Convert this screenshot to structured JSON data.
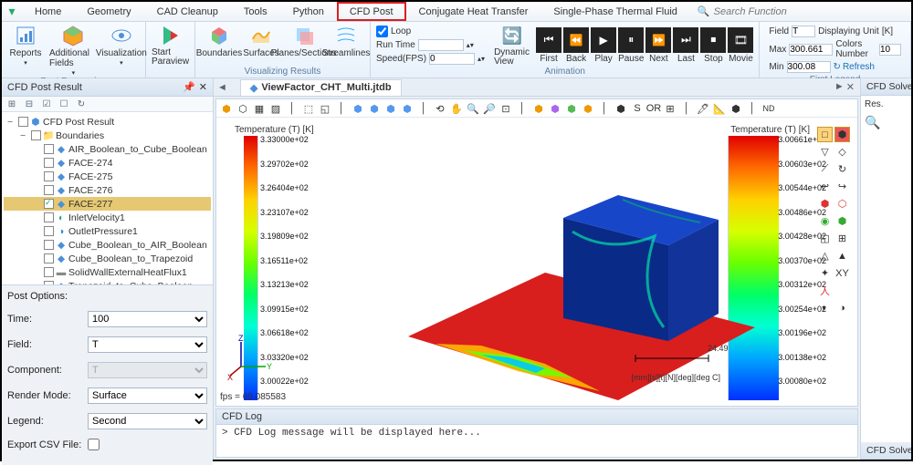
{
  "menubar": {
    "tabs": [
      "Home",
      "Geometry",
      "CAD Cleanup",
      "Tools",
      "Python",
      "CFD Post",
      "Conjugate Heat Transfer",
      "Single-Phase Thermal Fluid"
    ],
    "highlighted": "CFD Post",
    "search_placeholder": "Search Function"
  },
  "ribbon": {
    "groups": [
      {
        "label": "Post Processing",
        "items": [
          "Reports",
          "Additional Fields",
          "Visualization"
        ]
      },
      {
        "label": "",
        "items": [
          "Start Paraview"
        ]
      },
      {
        "label": "Visualizing Results",
        "items": [
          "Boundaries",
          "Surfaces",
          "Planes/Sections",
          "Streamlines"
        ]
      },
      {
        "label": "Animation",
        "loop": "Loop",
        "runtime": "Run Time",
        "speed": "Speed(FPS)",
        "speed_val": "0",
        "buttons": [
          "Dynamic View",
          "First",
          "Back",
          "Play",
          "Pause",
          "Next",
          "Last",
          "Stop",
          "Movie"
        ]
      },
      {
        "label": "First Legend",
        "field_lbl": "Field",
        "field_val": "T",
        "unit_lbl": "Displaying Unit",
        "unit_val": "[K]",
        "max_lbl": "Max",
        "max_val": "300.661",
        "colors_lbl": "Colors Number",
        "colors_val": "10",
        "min_lbl": "Min",
        "min_val": "300.08",
        "refresh": "Refresh"
      }
    ]
  },
  "left_panel": {
    "title": "CFD Post Result",
    "tree": [
      {
        "level": 0,
        "check": false,
        "icon": "cube",
        "label": "CFD Post Result",
        "expand": "−"
      },
      {
        "level": 1,
        "check": false,
        "icon": "folder",
        "label": "Boundaries",
        "expand": "−"
      },
      {
        "level": 2,
        "check": false,
        "icon": "face",
        "label": "AIR_Boolean_to_Cube_Boolean"
      },
      {
        "level": 2,
        "check": false,
        "icon": "face",
        "label": "FACE-274"
      },
      {
        "level": 2,
        "check": false,
        "icon": "face",
        "label": "FACE-275"
      },
      {
        "level": 2,
        "check": false,
        "icon": "face",
        "label": "FACE-276"
      },
      {
        "level": 2,
        "check": true,
        "icon": "face",
        "label": "FACE-277",
        "selected": true
      },
      {
        "level": 2,
        "check": false,
        "icon": "inlet",
        "label": "InletVelocity1"
      },
      {
        "level": 2,
        "check": false,
        "icon": "outlet",
        "label": "OutletPressure1"
      },
      {
        "level": 2,
        "check": false,
        "icon": "face",
        "label": "Cube_Boolean_to_AIR_Boolean"
      },
      {
        "level": 2,
        "check": false,
        "icon": "face",
        "label": "Cube_Boolean_to_Trapezoid"
      },
      {
        "level": 2,
        "check": false,
        "icon": "wall",
        "label": "SolidWallExternalHeatFlux1"
      },
      {
        "level": 2,
        "check": false,
        "icon": "face",
        "label": "Trapezoid_to_Cube_Boolean"
      }
    ],
    "post_options": {
      "header": "Post Options:",
      "rows": [
        {
          "label": "Time:",
          "value": "100",
          "type": "select"
        },
        {
          "label": "Field:",
          "value": "T",
          "type": "select"
        },
        {
          "label": "Component:",
          "value": "T",
          "type": "select",
          "disabled": true
        },
        {
          "label": "Render Mode:",
          "value": "Surface",
          "type": "select"
        },
        {
          "label": "Legend:",
          "value": "Second",
          "type": "select"
        },
        {
          "label": "Export CSV File:",
          "type": "checkbox"
        }
      ]
    }
  },
  "document": {
    "tab_title": "ViewFactor_CHT_Multi.jtdb"
  },
  "viewport": {
    "legend_left": {
      "title": "Temperature (T) [K]",
      "labels": [
        "3.33000e+02",
        "3.29702e+02",
        "3.26404e+02",
        "3.23107e+02",
        "3.19809e+02",
        "3.16511e+02",
        "3.13213e+02",
        "3.09915e+02",
        "3.06618e+02",
        "3.03320e+02",
        "3.00022e+02"
      ]
    },
    "legend_right": {
      "title": "Temperature (T) [K]",
      "labels": [
        "3.00661e+02",
        "3.00603e+02",
        "3.00544e+02",
        "3.00486e+02",
        "3.00428e+02",
        "3.00370e+02",
        "3.00312e+02",
        "3.00254e+02",
        "3.00196e+02",
        "3.00138e+02",
        "3.00080e+02"
      ]
    },
    "axes": [
      "Z",
      "X",
      "Y"
    ],
    "scale_value": "24.49",
    "scale_units": "[mm][s][t][N][deg][deg C]",
    "fps": "fps = 69.085583"
  },
  "log": {
    "title": "CFD Log",
    "message": "> CFD Log message will be displayed here..."
  },
  "right_panel": {
    "titles": [
      "CFD Solver",
      "Res.",
      "CFD Solve"
    ]
  }
}
